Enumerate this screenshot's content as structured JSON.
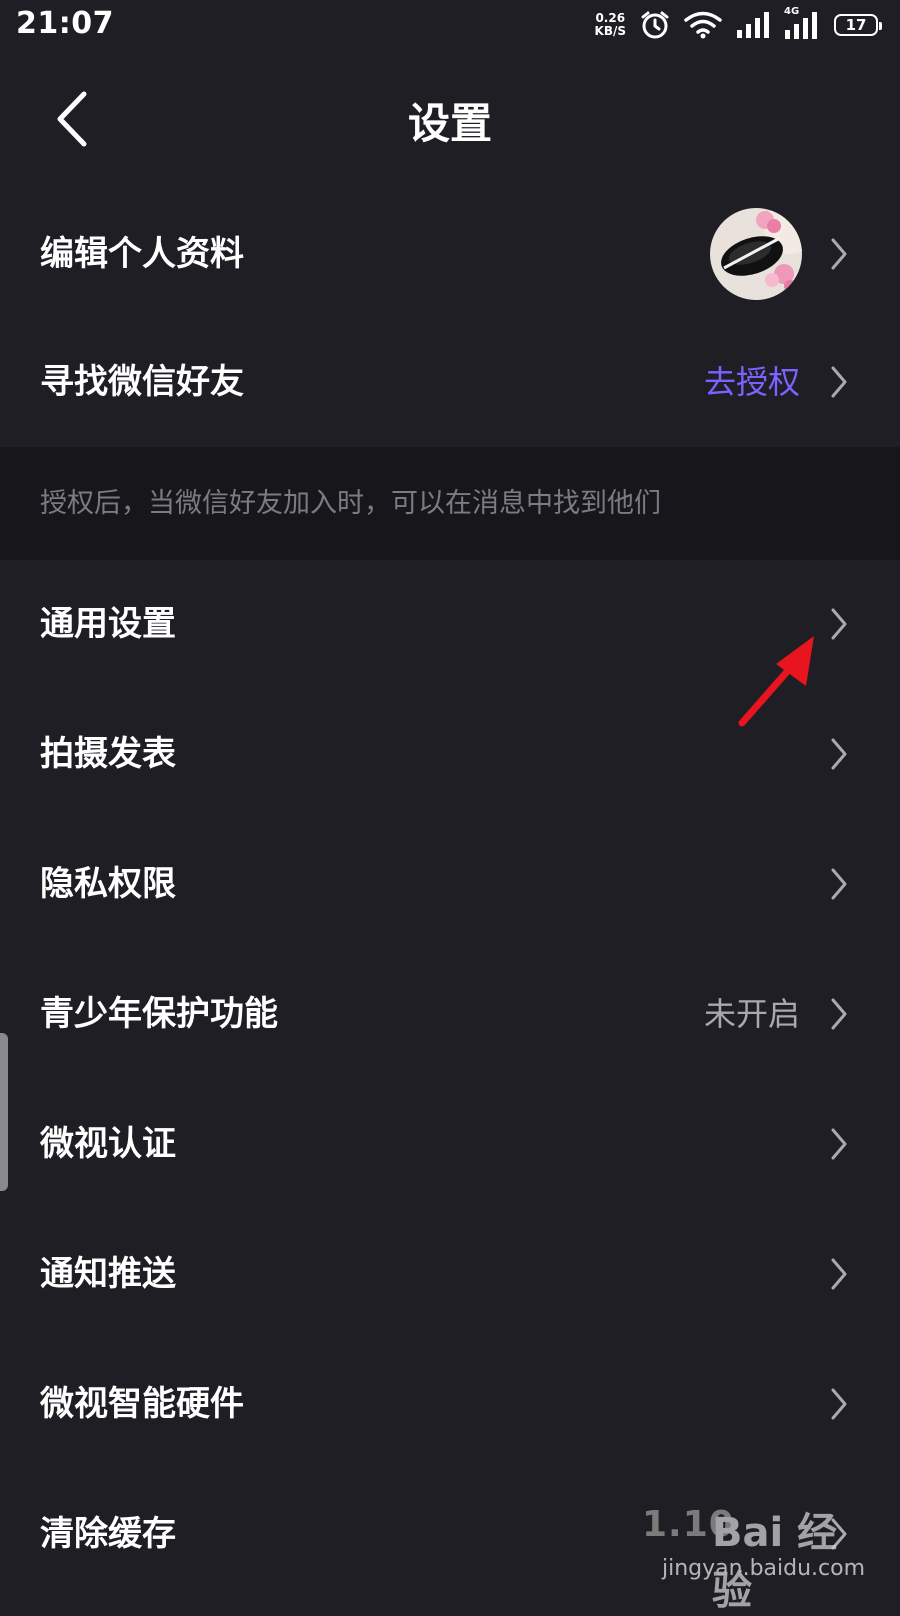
{
  "status_bar": {
    "time": "21:07",
    "net_speed_value": "0.26",
    "net_speed_unit": "KB/S",
    "network_type": "4G",
    "battery": "17",
    "icons": [
      "alarm-icon",
      "wifi-icon",
      "signal-icon",
      "signal-4g-icon",
      "battery-icon"
    ]
  },
  "header": {
    "back_icon": "chevron-left-icon",
    "title": "设置"
  },
  "account_section": {
    "edit_profile_label": "编辑个人资料",
    "wechat_friends_label": "寻找微信好友",
    "wechat_friends_action": "去授权"
  },
  "hint": "授权后，当微信好友加入时，可以在消息中找到他们",
  "menu": {
    "general_settings": "通用设置",
    "shoot_publish": "拍摄发表",
    "privacy": "隐私权限",
    "youth_protection": "青少年保护功能",
    "youth_protection_status": "未开启",
    "certification": "微视认证",
    "notifications": "通知推送",
    "smart_hardware": "微视智能硬件",
    "clear_cache": "清除缓存"
  },
  "watermark": {
    "version_fragment": "1.10",
    "brand": "Bai 经验",
    "url": "jingyan.baidu.com"
  },
  "colors": {
    "background": "#1f1e24",
    "hint_band": "#17161b",
    "accent": "#7a63ff",
    "annotation_arrow": "#e8141e"
  }
}
